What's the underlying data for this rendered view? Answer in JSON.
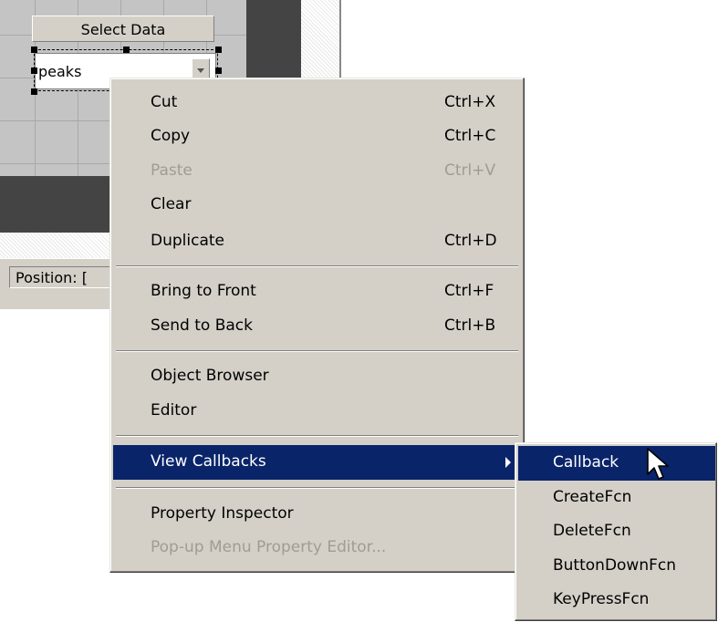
{
  "editor": {
    "select_button_label": "Select Data",
    "popup_value": "peaks",
    "status_position_label": "Position: ["
  },
  "context_menu": {
    "items": [
      {
        "label": "Cut",
        "shortcut": "Ctrl+X",
        "enabled": true
      },
      {
        "label": "Copy",
        "shortcut": "Ctrl+C",
        "enabled": true
      },
      {
        "label": "Paste",
        "shortcut": "Ctrl+V",
        "enabled": false
      },
      {
        "label": "Clear",
        "shortcut": "",
        "enabled": true
      },
      {
        "label": "Duplicate",
        "shortcut": "Ctrl+D",
        "enabled": true
      },
      {
        "label": "Bring to Front",
        "shortcut": "Ctrl+F",
        "enabled": true
      },
      {
        "label": "Send to Back",
        "shortcut": "Ctrl+B",
        "enabled": true
      },
      {
        "label": "Object Browser",
        "shortcut": "",
        "enabled": true
      },
      {
        "label": "Editor",
        "shortcut": "",
        "enabled": true
      },
      {
        "label": "View Callbacks",
        "shortcut": "",
        "enabled": true,
        "highlighted": true,
        "has_submenu": true
      },
      {
        "label": "Property Inspector",
        "shortcut": "",
        "enabled": true
      },
      {
        "label": "Pop-up Menu Property Editor...",
        "shortcut": "",
        "enabled": false
      }
    ]
  },
  "submenu": {
    "items": [
      {
        "label": "Callback",
        "highlighted": true
      },
      {
        "label": "CreateFcn"
      },
      {
        "label": "DeleteFcn"
      },
      {
        "label": "ButtonDownFcn"
      },
      {
        "label": "KeyPressFcn"
      }
    ]
  },
  "colors": {
    "menu_background": "#d4d0c8",
    "highlight": "#0a246a",
    "disabled_text": "#a09c94"
  },
  "icons": [
    "submenu-arrow-icon",
    "dropdown-arrow-icon",
    "mouse-pointer-icon"
  ]
}
